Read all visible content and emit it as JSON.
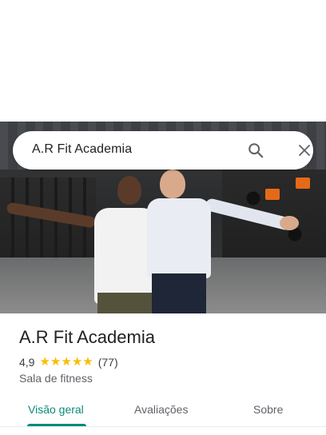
{
  "search": {
    "query": "A.R Fit Academia"
  },
  "place": {
    "name": "A.R Fit Academia",
    "rating": "4,9",
    "stars": 5,
    "review_count": "(77)",
    "category": "Sala de fitness"
  },
  "tabs": [
    {
      "label": "Visão geral",
      "active": true
    },
    {
      "label": "Avaliações",
      "active": false
    },
    {
      "label": "Sobre",
      "active": false
    }
  ],
  "colors": {
    "accent": "#0b8a7a",
    "star": "#fbbc04",
    "text_primary": "#202124",
    "text_secondary": "#5f6368"
  },
  "icons": {
    "search": "search-icon",
    "close": "close-icon",
    "star": "star-icon"
  }
}
